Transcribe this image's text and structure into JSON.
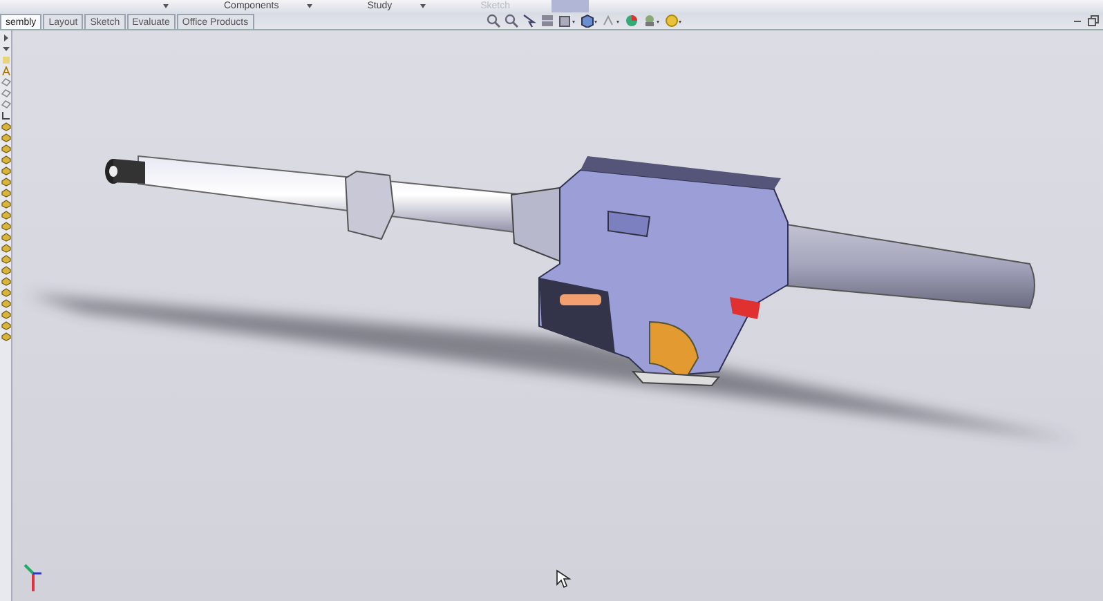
{
  "ribbon": {
    "groups": [
      {
        "label": "Components",
        "disabled": false
      },
      {
        "label": "Study",
        "disabled": false
      },
      {
        "label": "Sketch",
        "disabled": true
      }
    ]
  },
  "tabs": [
    {
      "label": "sembly",
      "selected": true
    },
    {
      "label": "Layout",
      "selected": false
    },
    {
      "label": "Sketch",
      "selected": false
    },
    {
      "label": "Evaluate",
      "selected": false
    },
    {
      "label": "Office Products",
      "selected": false
    }
  ]
}
